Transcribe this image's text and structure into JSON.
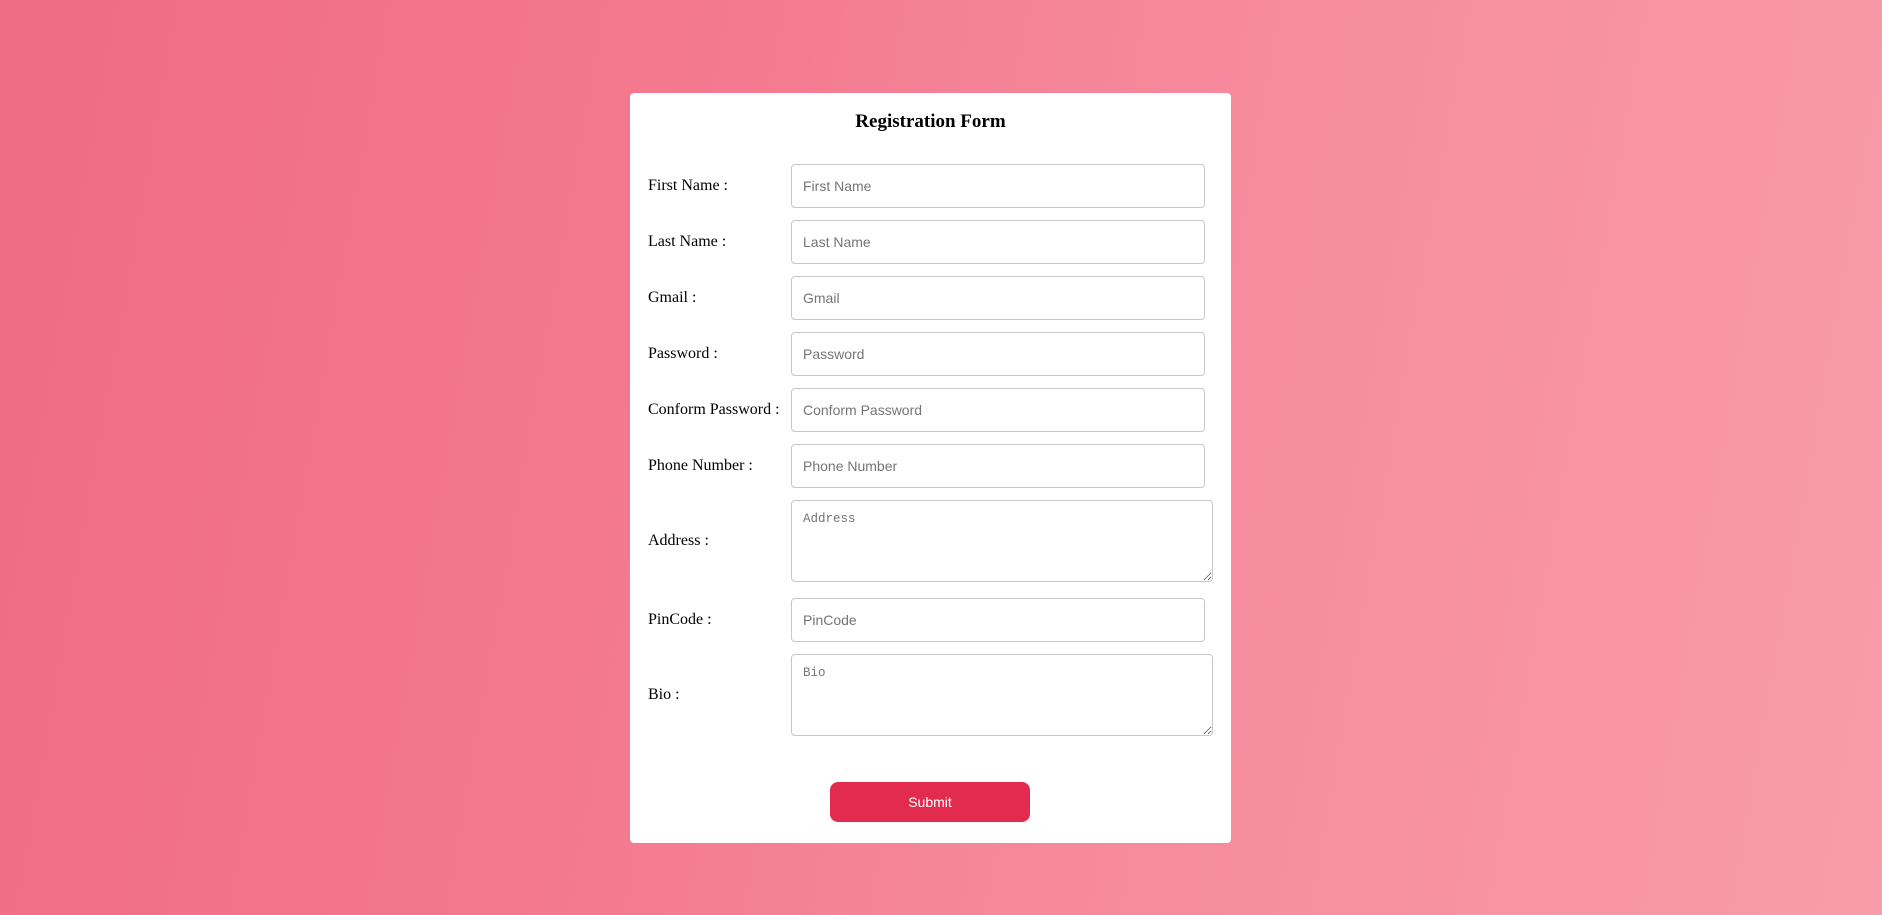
{
  "form": {
    "title": "Registration Form",
    "fields": [
      {
        "label": "First Name :",
        "placeholder": "First Name",
        "value": ""
      },
      {
        "label": "Last Name :",
        "placeholder": "Last Name",
        "value": ""
      },
      {
        "label": "Gmail :",
        "placeholder": "Gmail",
        "value": ""
      },
      {
        "label": "Password :",
        "placeholder": "Password",
        "value": ""
      },
      {
        "label": "Conform Password :",
        "placeholder": "Conform Password",
        "value": ""
      },
      {
        "label": "Phone Number :",
        "placeholder": "Phone Number",
        "value": ""
      },
      {
        "label": "Address :",
        "placeholder": "Address",
        "value": ""
      },
      {
        "label": "PinCode :",
        "placeholder": "PinCode",
        "value": ""
      },
      {
        "label": "Bio :",
        "placeholder": "Bio",
        "value": ""
      }
    ],
    "submit_label": "Submit"
  },
  "colors": {
    "accent": "#e22b4e",
    "background_start": "#f06b84",
    "background_end": "#f99ca9",
    "card": "#ffffff"
  }
}
